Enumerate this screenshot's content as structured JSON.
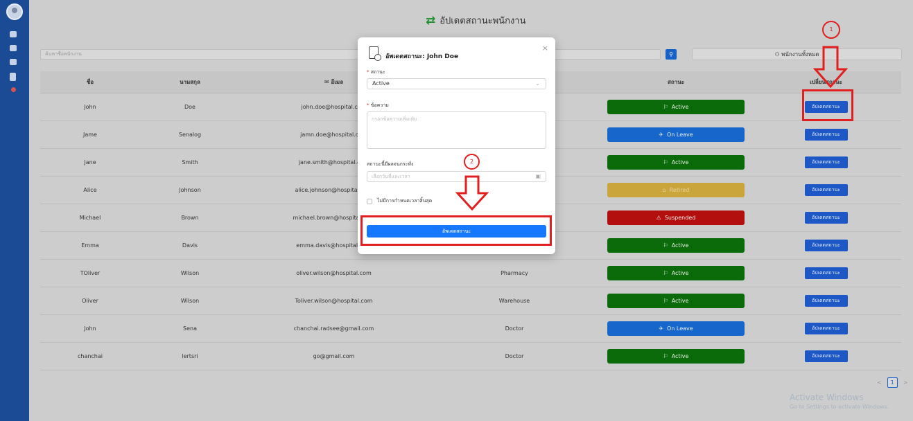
{
  "page": {
    "title": "อัปเดตสถานะพนักงาน",
    "title_icon": "swap-arrows-icon"
  },
  "search": {
    "placeholder": "ค้นหาชื่อพนักงาน",
    "button_icon": "search-icon"
  },
  "filter": {
    "label": "พนักงานทั้งหมด",
    "icon": "user-icon"
  },
  "table": {
    "headers": [
      "ชื่อ",
      "นามสกุล",
      "อีเมล",
      "",
      "สถานะ",
      "เปลี่ยนสถานะ"
    ],
    "rows": [
      {
        "first": "John",
        "last": "Doe",
        "email": "john.doe@hospital.com",
        "dept": "",
        "status": "Active",
        "status_kind": "active"
      },
      {
        "first": "Jame",
        "last": "Senalog",
        "email": "jamn.doe@hospital.com",
        "dept": "",
        "status": "On Leave",
        "status_kind": "onleave"
      },
      {
        "first": "Jane",
        "last": "Smith",
        "email": "jane.smith@hospital.com",
        "dept": "",
        "status": "Active",
        "status_kind": "active"
      },
      {
        "first": "Alice",
        "last": "Johnson",
        "email": "alice.johnson@hospital.com",
        "dept": "",
        "status": "Retired",
        "status_kind": "retired"
      },
      {
        "first": "Michael",
        "last": "Brown",
        "email": "michael.brown@hospital.com",
        "dept": "",
        "status": "Suspended",
        "status_kind": "suspended"
      },
      {
        "first": "Emma",
        "last": "Davis",
        "email": "emma.davis@hospital.com",
        "dept": "",
        "status": "Active",
        "status_kind": "active"
      },
      {
        "first": "TOliver",
        "last": "Wilson",
        "email": "oliver.wilson@hospital.com",
        "dept": "Pharmacy",
        "status": "Active",
        "status_kind": "active"
      },
      {
        "first": "Oliver",
        "last": "Wilson",
        "email": "Toliver.wilson@hospital.com",
        "dept": "Warehouse",
        "status": "Active",
        "status_kind": "active"
      },
      {
        "first": "John",
        "last": "Sena",
        "email": "chanchai.radsee@gmail.com",
        "dept": "Doctor",
        "status": "On Leave",
        "status_kind": "onleave"
      },
      {
        "first": "chanchai",
        "last": "lertsri",
        "email": "go@gmail.com",
        "dept": "Doctor",
        "status": "Active",
        "status_kind": "active"
      }
    ],
    "update_button_label": "อัปเดตสถานะ"
  },
  "pagination": {
    "prev": "<",
    "current": "1",
    "next": ">"
  },
  "watermark": {
    "line1": "Activate Windows",
    "line2": "Go to Settings to activate Windows."
  },
  "annotations": {
    "step1": "1",
    "step2": "2"
  },
  "modal": {
    "title": "อัพเดตสถานะ: John Doe",
    "close": "×",
    "status_label": "สถานะ",
    "status_value": "Active",
    "message_label": "ข้อความ",
    "message_placeholder": "กรอกข้อความเพิ่มเติม",
    "effective_label": "สถานะนี้มีผลจนกระทั่ง",
    "date_placeholder": "เลือกวันที่และเวลา",
    "no_end_label": "ไม่มีการกำหนดเวลาสิ้นสุด",
    "submit_label": "อัพเดตสถานะ"
  }
}
